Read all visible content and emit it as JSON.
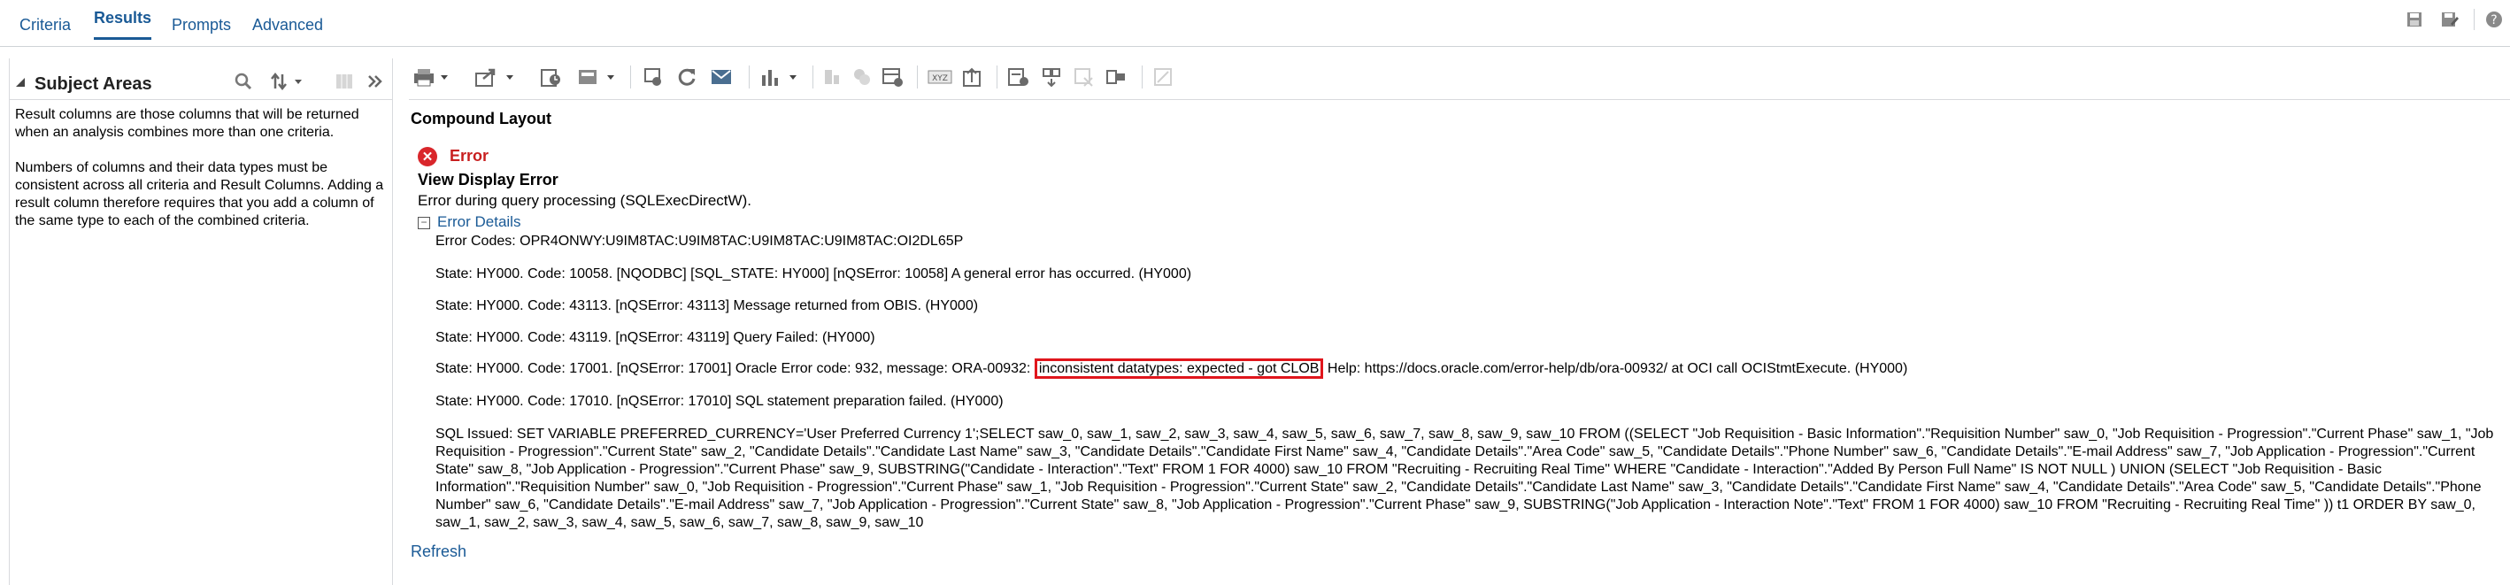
{
  "tabs": [
    {
      "label": "Criteria"
    },
    {
      "label": "Results"
    },
    {
      "label": "Prompts"
    },
    {
      "label": "Advanced"
    }
  ],
  "top_right_icons": [
    "save-icon",
    "save-as-icon",
    "help-icon"
  ],
  "sidebar": {
    "title": "Subject Areas",
    "paragraph1": "Result columns are those columns that will be returned when an analysis combines more than one criteria.",
    "paragraph2": "Numbers of columns and their data types must be consistent across all criteria and Result Columns. Adding a result column therefore requires that you add a column of the same type to each of the combined criteria."
  },
  "layout_title": "Compound Layout",
  "error": {
    "label": "Error",
    "title": "View Display Error",
    "subtitle": "Error during query processing (SQLExecDirectW).",
    "details_link": "Error Details",
    "codes": "Error Codes: OPR4ONWY:U9IM8TAC:U9IM8TAC:U9IM8TAC:U9IM8TAC:OI2DL65P",
    "state1": "State: HY000. Code: 10058. [NQODBC] [SQL_STATE: HY000] [nQSError: 10058] A general error has occurred. (HY000)",
    "state2": "State: HY000. Code: 43113. [nQSError: 43113] Message returned from OBIS. (HY000)",
    "state3": "State: HY000. Code: 43119. [nQSError: 43119] Query Failed: (HY000)",
    "state4_pre": "State: HY000. Code: 17001. [nQSError: 17001] Oracle Error code: 932, message: ORA-00932: ",
    "state4_highlight": "inconsistent datatypes: expected - got CLOB",
    "state4_post": " Help: https://docs.oracle.com/error-help/db/ora-00932/ at OCI call OCIStmtExecute. (HY000)",
    "state5": "State: HY000. Code: 17010. [nQSError: 17010] SQL statement preparation failed. (HY000)",
    "sql": "SQL Issued: SET VARIABLE PREFERRED_CURRENCY='User Preferred Currency 1';SELECT saw_0, saw_1, saw_2, saw_3, saw_4, saw_5, saw_6, saw_7, saw_8, saw_9, saw_10 FROM ((SELECT \"Job Requisition - Basic Information\".\"Requisition Number\" saw_0, \"Job Requisition - Progression\".\"Current Phase\" saw_1, \"Job Requisition - Progression\".\"Current State\" saw_2, \"Candidate Details\".\"Candidate Last Name\" saw_3, \"Candidate Details\".\"Candidate First Name\" saw_4, \"Candidate Details\".\"Area Code\" saw_5, \"Candidate Details\".\"Phone Number\" saw_6, \"Candidate Details\".\"E-mail Address\" saw_7, \"Job Application - Progression\".\"Current State\" saw_8, \"Job Application - Progression\".\"Current Phase\" saw_9, SUBSTRING(\"Candidate - Interaction\".\"Text\" FROM 1 FOR 4000) saw_10 FROM \"Recruiting - Recruiting Real Time\" WHERE \"Candidate - Interaction\".\"Added By Person Full Name\" IS NOT NULL ) UNION (SELECT \"Job Requisition - Basic Information\".\"Requisition Number\" saw_0, \"Job Requisition - Progression\".\"Current Phase\" saw_1, \"Job Requisition - Progression\".\"Current State\" saw_2, \"Candidate Details\".\"Candidate Last Name\" saw_3, \"Candidate Details\".\"Candidate First Name\" saw_4, \"Candidate Details\".\"Area Code\" saw_5, \"Candidate Details\".\"Phone Number\" saw_6, \"Candidate Details\".\"E-mail Address\" saw_7, \"Job Application - Progression\".\"Current State\" saw_8, \"Job Application - Progression\".\"Current Phase\" saw_9, SUBSTRING(\"Job Application - Interaction Note\".\"Text\" FROM 1 FOR 4000) saw_10 FROM \"Recruiting - Recruiting Real Time\" )) t1 ORDER BY saw_0, saw_1, saw_2, saw_3, saw_4, saw_5, saw_6, saw_7, saw_8, saw_9, saw_10"
  },
  "refresh_label": "Refresh",
  "colors": {
    "link": "#1a5a96",
    "error": "#c81f1f",
    "highlight_border": "#e0161c"
  }
}
